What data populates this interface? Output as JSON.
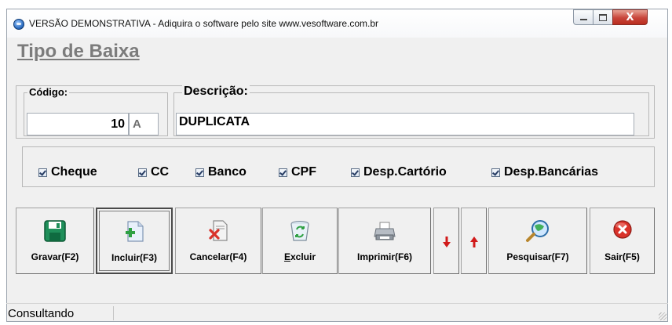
{
  "window": {
    "title": "VERSÃO DEMONSTRATIVA - Adiquira o software pelo site www.vesoftware.com.br",
    "close_glyph": "X"
  },
  "page": {
    "title": "Tipo de Baixa"
  },
  "form": {
    "codigo_label": "Código:",
    "codigo_value": "10",
    "codigo_suffix": "A",
    "descricao_label": "Descrição:",
    "descricao_value": "DUPLICATA"
  },
  "checkboxes": [
    {
      "label": "Cheque",
      "checked": true
    },
    {
      "label": "CC",
      "checked": true
    },
    {
      "label": "Banco",
      "checked": true
    },
    {
      "label": "CPF",
      "checked": true
    },
    {
      "label": "Desp.Cartório",
      "checked": true
    },
    {
      "label": "Desp.Bancárias",
      "checked": true
    }
  ],
  "toolbar": {
    "gravar": {
      "label": "Gravar(F2)",
      "icon": "floppy-disk-icon"
    },
    "incluir": {
      "label": "Incluir(F3)",
      "icon": "add-document-icon"
    },
    "cancelar": {
      "label": "Cancelar(F4)",
      "icon": "cancel-document-icon"
    },
    "excluir": {
      "label_first": "E",
      "label_rest": "xcluir",
      "icon": "recycle-bin-icon"
    },
    "imprimir": {
      "label": "Imprimir(F6)",
      "icon": "printer-icon"
    },
    "down": {
      "icon": "arrow-down-icon"
    },
    "up": {
      "icon": "arrow-up-icon"
    },
    "pesquisar": {
      "label": "Pesquisar(F7)",
      "icon": "magnifier-icon"
    },
    "sair": {
      "label": "Sair(F5)",
      "icon": "exit-icon"
    }
  },
  "status": {
    "text": "Consultando"
  },
  "colors": {
    "accent_green": "#1f8f5a",
    "arrow_red": "#d11a1a",
    "exit_red": "#d9322a"
  }
}
